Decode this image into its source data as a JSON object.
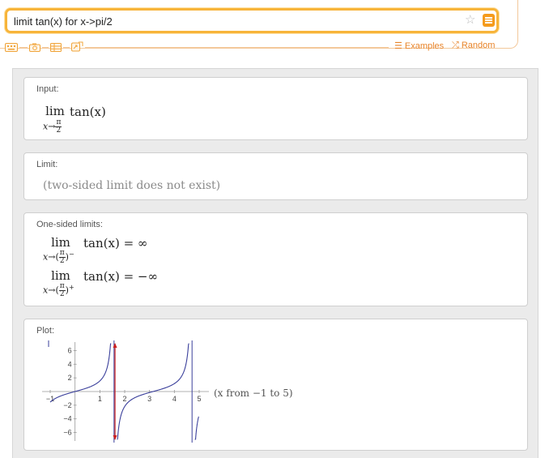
{
  "search": {
    "query": "limit tan(x) for x->pi/2"
  },
  "toolbar": {
    "icons": [
      "keyboard-icon",
      "camera-icon",
      "table-icon",
      "random-tool-icon"
    ],
    "examples_label": "Examples",
    "random_label": "Random"
  },
  "pods": {
    "input": {
      "title": "Input:",
      "lim": "lim",
      "sub_var": "x",
      "arrow": "→",
      "sub_num": "π",
      "sub_den": "2",
      "expr": "tan(x)"
    },
    "limit": {
      "title": "Limit:",
      "result": "(two-sided limit does not exist)"
    },
    "one_sided": {
      "title": "One-sided limits:",
      "rows": [
        {
          "lim": "lim",
          "var": "x",
          "arrow": "→",
          "num": "π",
          "den": "2",
          "side": "−",
          "expr": "tan(x) = ∞"
        },
        {
          "lim": "lim",
          "var": "x",
          "arrow": "→",
          "num": "π",
          "den": "2",
          "side": "+",
          "expr": "tan(x) = −∞"
        }
      ]
    },
    "plot": {
      "title": "Plot:",
      "range_note": "(x from −1 to 5)"
    }
  },
  "chart_data": {
    "type": "line",
    "title": "",
    "function": "tan(x)",
    "xlim": [
      -1,
      5
    ],
    "ylim": [
      -7,
      7
    ],
    "x_ticks": [
      -1,
      1,
      2,
      3,
      4,
      5
    ],
    "y_ticks": [
      6,
      4,
      2,
      -2,
      -4,
      -6
    ],
    "asymptotes": [
      1.5708,
      4.7124
    ],
    "highlight_x": 1.5708,
    "colors": {
      "curve": "#3a3f9b",
      "asymptote": "#3a3f9b",
      "highlight": "#cc1e1e"
    },
    "grid": false
  }
}
